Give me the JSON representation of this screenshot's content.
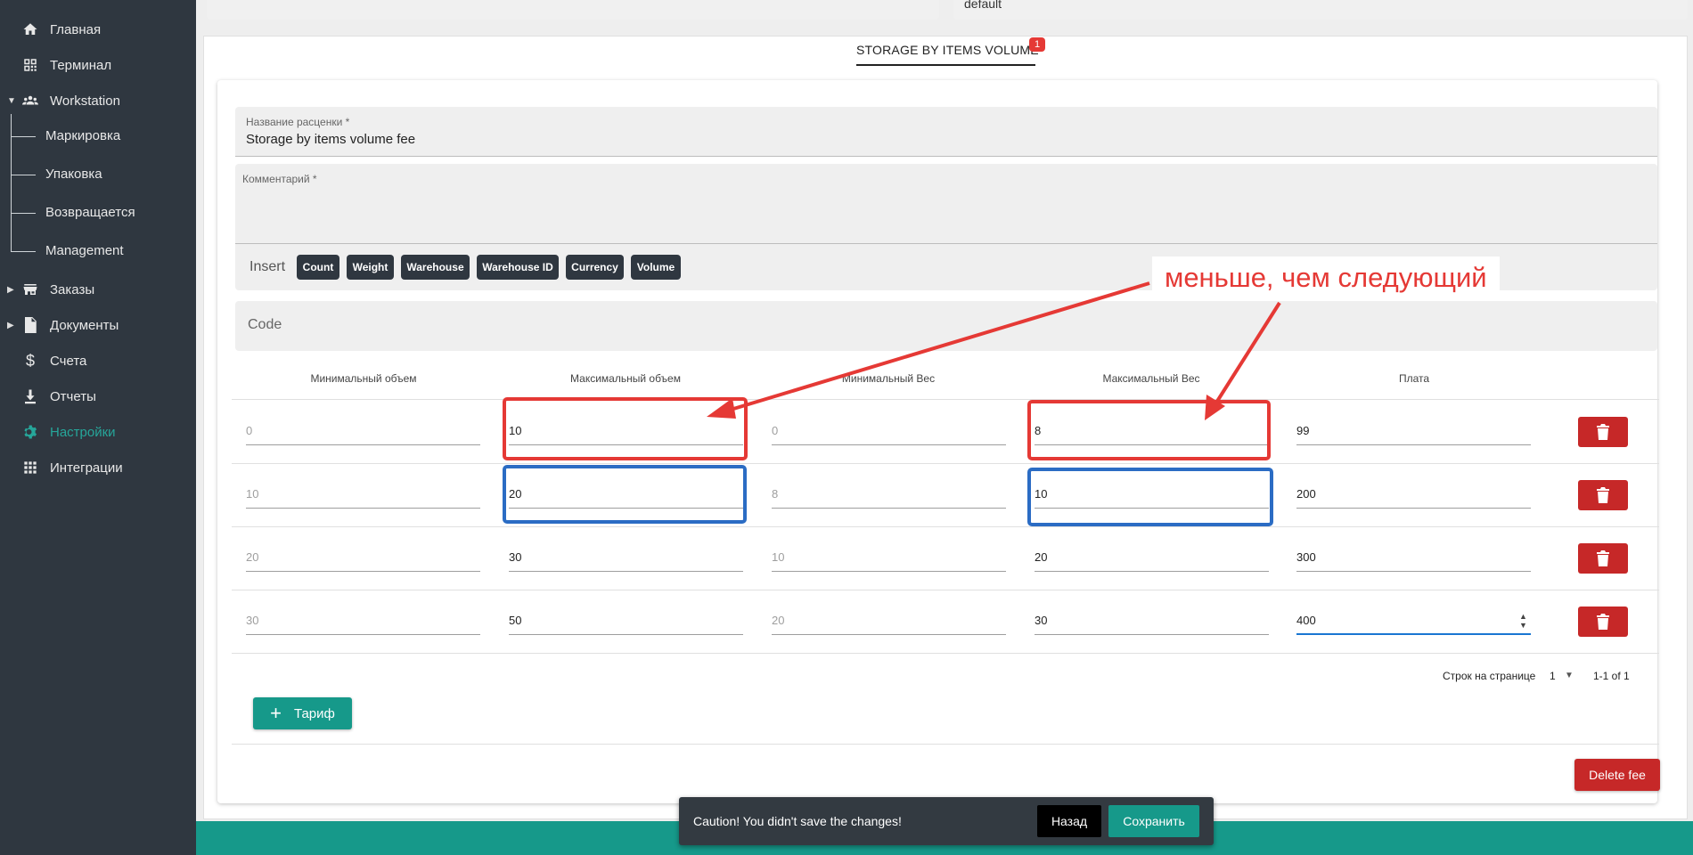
{
  "sidebar": {
    "items": [
      {
        "label": "Главная",
        "icon": "home-icon"
      },
      {
        "label": "Терминал",
        "icon": "qr-icon"
      },
      {
        "label": "Workstation",
        "icon": "group-icon"
      },
      {
        "label": "Заказы",
        "icon": "store-icon"
      },
      {
        "label": "Документы",
        "icon": "document-icon"
      },
      {
        "label": "Счета",
        "icon": "dollar-icon"
      },
      {
        "label": "Отчеты",
        "icon": "download-icon"
      },
      {
        "label": "Настройки",
        "icon": "gear-icon"
      },
      {
        "label": "Интеграции",
        "icon": "apps-icon"
      }
    ],
    "workstation_children": [
      "Маркировка",
      "Упаковка",
      "Возвращается",
      "Management"
    ],
    "active_label": "Настройки",
    "accent": "#26a69a"
  },
  "top": {
    "right_value": "default"
  },
  "tab": {
    "label": "STORAGE BY ITEMS VOLUME",
    "badge": "1"
  },
  "form": {
    "name_label": "Название расценки *",
    "name_value": "Storage by items volume fee",
    "comment_label": "Комментарий *",
    "insert_label": "Insert",
    "chips": [
      "Count",
      "Weight",
      "Warehouse",
      "Warehouse ID",
      "Currency",
      "Volume"
    ],
    "code_placeholder": "Code"
  },
  "table": {
    "headers": [
      "Минимальный объем",
      "Максимальный объем",
      "Минимальный Вес",
      "Максимальный Вес",
      "Плата"
    ],
    "rows": [
      [
        "0",
        "10",
        "0",
        "8",
        "99"
      ],
      [
        "10",
        "20",
        "8",
        "10",
        "200"
      ],
      [
        "20",
        "30",
        "10",
        "20",
        "300"
      ],
      [
        "30",
        "50",
        "20",
        "30",
        "400"
      ]
    ]
  },
  "pagination": {
    "rows_per_page_label": "Строк на странице",
    "rows_per_page_value": "1",
    "range": "1-1 of 1"
  },
  "buttons": {
    "add_tariff": "Тариф",
    "delete_fee": "Delete fee"
  },
  "snackbar": {
    "message": "Caution! You didn't save the changes!",
    "back": "Назад",
    "save": "Сохранить"
  },
  "annotation": {
    "callout": "меньше, чем следующий",
    "red": "#e53935",
    "blue": "#2b6cc4"
  }
}
